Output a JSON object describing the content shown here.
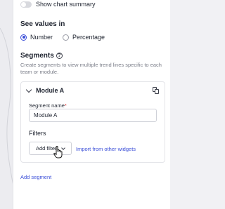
{
  "show_chart_summary": {
    "label": "Show chart summary",
    "enabled": false
  },
  "values_section": {
    "title": "See values in",
    "options": [
      {
        "label": "Number",
        "selected": true
      },
      {
        "label": "Percentage",
        "selected": false
      }
    ]
  },
  "segments": {
    "title": "Segments",
    "description": "Create segments to view multiple trend lines specific to each team or module.",
    "segment": {
      "name": "Module A",
      "name_field_label": "Segment name",
      "required_marker": "*",
      "name_value": "Module A",
      "filters_title": "Filters",
      "add_filter_label": "Add filter",
      "import_label": "Import from other widgets"
    },
    "add_segment_label": "Add segment"
  },
  "colors": {
    "accent": "#3b4fd8",
    "required": "#dd3333"
  }
}
